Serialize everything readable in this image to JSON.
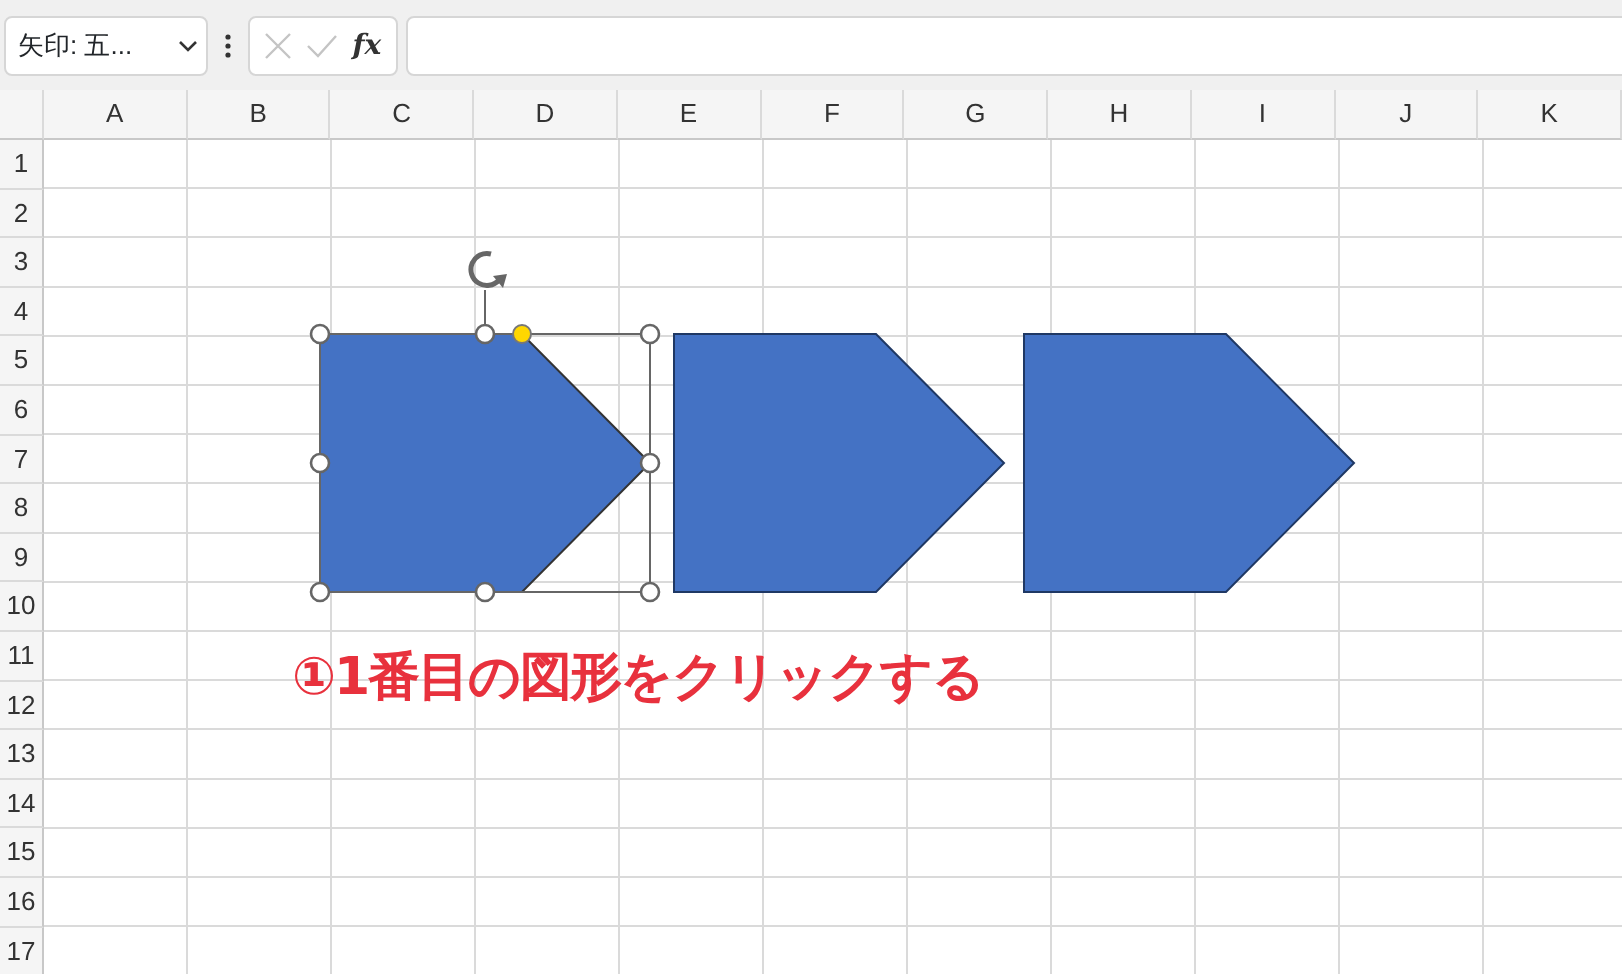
{
  "name_box": {
    "value": "矢印: 五..."
  },
  "formula_bar": {
    "fx_label": "fx"
  },
  "columns": [
    "A",
    "B",
    "C",
    "D",
    "E",
    "F",
    "G",
    "H",
    "I",
    "J",
    "K"
  ],
  "rows": [
    "1",
    "2",
    "3",
    "4",
    "5",
    "6",
    "7",
    "8",
    "9",
    "10",
    "11",
    "12",
    "13",
    "14",
    "15",
    "16",
    "17"
  ],
  "shapes": [
    {
      "kind": "pentagon-arrow",
      "selected": true
    },
    {
      "kind": "pentagon-arrow",
      "selected": false
    },
    {
      "kind": "pentagon-arrow",
      "selected": false
    }
  ],
  "annotation": {
    "marker": "①",
    "text": "1番目の図形をクリックする"
  }
}
